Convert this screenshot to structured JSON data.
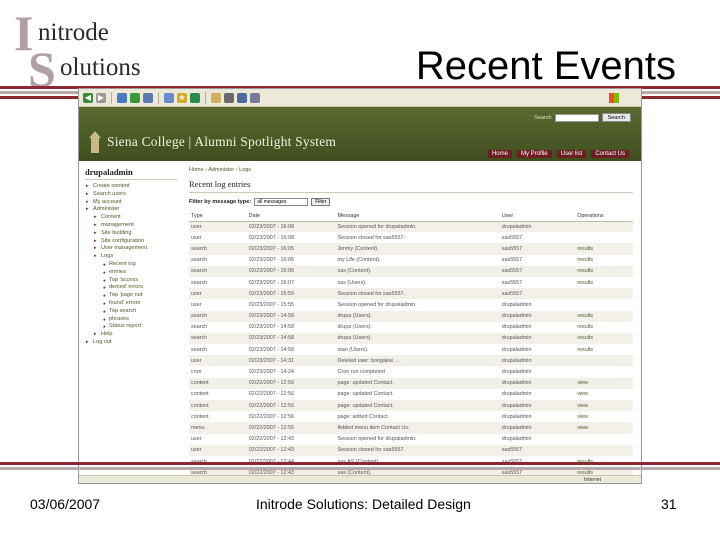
{
  "slide": {
    "logo": {
      "initial1": "I",
      "line1": "nitrode",
      "initial2": "S",
      "line2": "olutions"
    },
    "title": "Recent Events",
    "footer": {
      "date": "03/06/2007",
      "center": "Initrode Solutions: Detailed Design",
      "page": "31"
    }
  },
  "site": {
    "name": "Siena College | Alumni Spotlight System",
    "search_label": "Search",
    "search_button": "Search",
    "nav": [
      "Home",
      "My Profile",
      "User list",
      "Contact Us"
    ]
  },
  "sidebar": {
    "username": "drupaladmin",
    "items": [
      {
        "label": "Create content",
        "level": 1
      },
      {
        "label": "Search users",
        "level": 1
      },
      {
        "label": "My account",
        "level": 1
      },
      {
        "label": "Administer",
        "level": 1
      },
      {
        "label": "Content",
        "level": 2
      },
      {
        "label": "management",
        "level": 2
      },
      {
        "label": "Site building",
        "level": 2
      },
      {
        "label": "Site configuration",
        "level": 2
      },
      {
        "label": "User management",
        "level": 2
      },
      {
        "label": "Logs",
        "level": 2
      },
      {
        "label": "Recent log",
        "level": 3
      },
      {
        "label": "entries",
        "level": 3
      },
      {
        "label": "Top 'access",
        "level": 3
      },
      {
        "label": "denied' errors",
        "level": 3
      },
      {
        "label": "Top 'page not",
        "level": 3
      },
      {
        "label": "found' errors",
        "level": 3
      },
      {
        "label": "Top search",
        "level": 3
      },
      {
        "label": "phrases",
        "level": 3
      },
      {
        "label": "Status report",
        "level": 3
      },
      {
        "label": "Help",
        "level": 2
      },
      {
        "label": "Log out",
        "level": 1
      }
    ]
  },
  "main": {
    "breadcrumb": "Home › Administer › Logs",
    "title": "Recent log entries",
    "filter_label": "Filter by message type:",
    "filter_value": "all messages",
    "filter_button": "Filter",
    "columns": [
      "Type",
      "Date",
      "Message",
      "User",
      "Operations"
    ],
    "rows": [
      [
        "user",
        "02/23/2007 - 16:08",
        "Session opened for drupaladmin.",
        "drupaladmin",
        ""
      ],
      [
        "user",
        "02/23/2007 - 16:08",
        "Session closed for sas5557.",
        "sas5557",
        ""
      ],
      [
        "search",
        "02/23/2007 - 16:05",
        "Jimmy (Content).",
        "sas5557",
        "results"
      ],
      [
        "search",
        "02/23/2007 - 16:05",
        "my Life (Content).",
        "sas5557",
        "results"
      ],
      [
        "search",
        "02/23/2007 - 16:05",
        "sas (Content).",
        "sas5557",
        "results"
      ],
      [
        "search",
        "02/23/2007 - 16:07",
        "sas (Users).",
        "sas5557",
        "results"
      ],
      [
        "user",
        "02/23/2007 - 15:55",
        "Session closed for sas5557.",
        "sas5557",
        ""
      ],
      [
        "user",
        "02/23/2007 - 15:55",
        "Session opened for drupaladmin.",
        "drupaladmin",
        ""
      ],
      [
        "search",
        "02/23/2007 - 14:58",
        "drupa (Users).",
        "drupaladmin",
        "results"
      ],
      [
        "search",
        "02/23/2007 - 14:58",
        "drupa (Users).",
        "drupaladmin",
        "results"
      ],
      [
        "search",
        "02/23/2007 - 14:58",
        "drupa (Users).",
        "drupaladmin",
        "results"
      ],
      [
        "search",
        "02/23/2007 - 14:58",
        "stan (Users).",
        "drupaladmin",
        "results"
      ],
      [
        "user",
        "02/23/2007 - 14:31",
        "Deleted user: boogaloe ...",
        "drupaladmin",
        ""
      ],
      [
        "cron",
        "02/23/2007 - 14:24",
        "Cron run completed",
        "drupaladmin",
        ""
      ],
      [
        "content",
        "02/22/2007 - 12:56",
        "page: updated Contact.",
        "drupaladmin",
        "view"
      ],
      [
        "content",
        "02/22/2007 - 12:56",
        "page: updated Contact.",
        "drupaladmin",
        "view"
      ],
      [
        "content",
        "02/22/2007 - 12:56",
        "page: updated Contact.",
        "drupaladmin",
        "view"
      ],
      [
        "content",
        "02/22/2007 - 12:56",
        "page: added Contact.",
        "drupaladmin",
        "view"
      ],
      [
        "menu",
        "02/22/2007 - 12:55",
        "Added menu item Contact Us.",
        "drupaladmin",
        "view"
      ],
      [
        "user",
        "02/22/2007 - 12:43",
        "Session opened for drupaladmin.",
        "drupaladmin",
        ""
      ],
      [
        "user",
        "02/22/2007 - 12:43",
        "Session closed for sas5557.",
        "sas5557",
        ""
      ],
      [
        "search",
        "02/22/2007 - 12:44",
        "sas AS (Content).",
        "sas5557",
        "results"
      ],
      [
        "search",
        "02/22/2007 - 12:43",
        "sas (Content).",
        "sas5557",
        "results"
      ]
    ]
  },
  "statusbar": {
    "zone": "Internet"
  },
  "colors": {
    "brand_green": "#4a5a26",
    "brand_maroon": "#6d1e24",
    "stripe": "#8b2a2e"
  }
}
